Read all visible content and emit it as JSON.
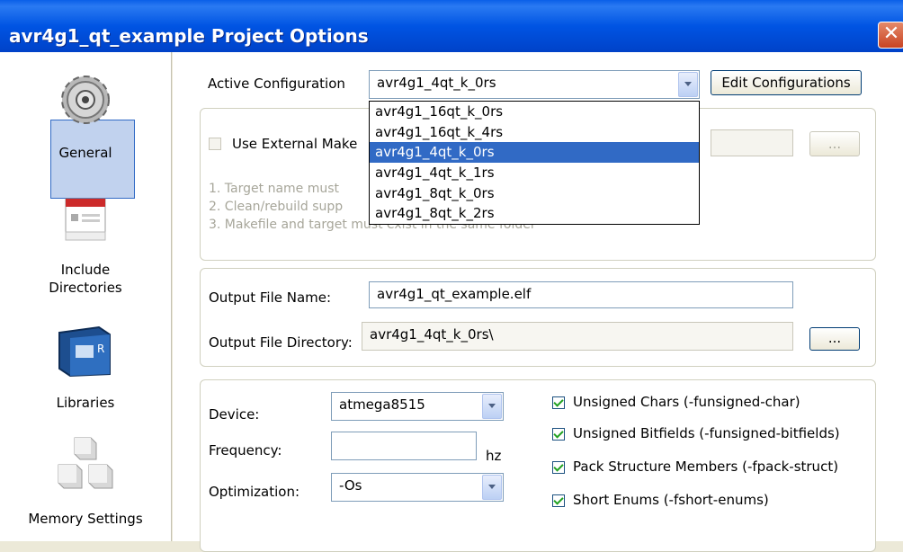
{
  "window": {
    "title": "avr4g1_qt_example Project Options",
    "close_glyph": "✕"
  },
  "sidebar": {
    "items": [
      {
        "label": "General",
        "icon": "gear-icon"
      },
      {
        "label": "Include\nDirectories",
        "icon": "folder-list-icon"
      },
      {
        "label": "Libraries",
        "icon": "book-icon"
      },
      {
        "label": "Memory Settings",
        "icon": "blocks-icon"
      }
    ]
  },
  "config": {
    "active_label": "Active Configuration",
    "selected": "avr4g1_4qt_k_0rs",
    "edit_button": "Edit Configurations",
    "options": [
      "avr4g1_16qt_k_0rs",
      "avr4g1_16qt_k_4rs",
      "avr4g1_4qt_k_0rs",
      "avr4g1_4qt_k_1rs",
      "avr4g1_8qt_k_0rs",
      "avr4g1_8qt_k_2rs"
    ],
    "highlighted_index": 2
  },
  "makefile": {
    "checkbox_label": "Use External Make",
    "browse_label": "...",
    "notes": [
      "1. Target name must",
      "2. Clean/rebuild supp",
      "3. Makefile and target must exist in the same folder"
    ]
  },
  "output": {
    "file_name_label": "Output File Name:",
    "file_name_value": "avr4g1_qt_example.elf",
    "dir_label": "Output File Directory:",
    "dir_value": "avr4g1_4qt_k_0rs\\",
    "browse_label": "..."
  },
  "device": {
    "device_label": "Device:",
    "device_value": "atmega8515",
    "frequency_label": "Frequency:",
    "frequency_value": "",
    "frequency_unit": "hz",
    "optimization_label": "Optimization:",
    "optimization_value": "-Os"
  },
  "flags": [
    {
      "label": "Unsigned Chars (-funsigned-char)",
      "checked": true
    },
    {
      "label": "Unsigned Bitfields (-funsigned-bitfields)",
      "checked": true
    },
    {
      "label": "Pack Structure Members (-fpack-struct)",
      "checked": true
    },
    {
      "label": "Short Enums (-fshort-enums)",
      "checked": true
    }
  ],
  "colors": {
    "titlebar": "#0054e3",
    "selection": "#316ac5",
    "check": "#21a121"
  }
}
